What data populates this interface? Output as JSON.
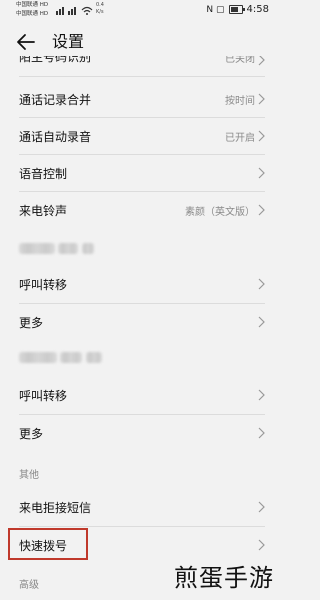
{
  "status_bar": {
    "carrier1": "中国联通 HD",
    "carrier2": "中国联通 HD",
    "speed_line1": "0.4",
    "speed_line2": "K/s",
    "icons": "N ▢",
    "time": "4:58"
  },
  "header": {
    "title": "设置"
  },
  "rows": {
    "partial": {
      "label": "陌生号码识别",
      "value": "已关闭"
    },
    "merge": {
      "label": "通话记录合并",
      "value": "按时间"
    },
    "autorecord": {
      "label": "通话自动录音",
      "value": "已开启"
    },
    "voice": {
      "label": "语音控制",
      "value": ""
    },
    "ringtone": {
      "label": "来电铃声",
      "value": "素颜（英文版）"
    },
    "forward1": {
      "label": "呼叫转移"
    },
    "more1": {
      "label": "更多"
    },
    "forward2": {
      "label": "呼叫转移"
    },
    "more2": {
      "label": "更多"
    },
    "reject_sms": {
      "label": "来电拒接短信"
    },
    "speed_dial": {
      "label": "快速拨号"
    }
  },
  "sections": {
    "other": "其他",
    "advanced": "高级"
  },
  "watermark": "煎蛋手游",
  "colors": {
    "highlight": "#c0392b",
    "background": "#f2f2f2"
  }
}
